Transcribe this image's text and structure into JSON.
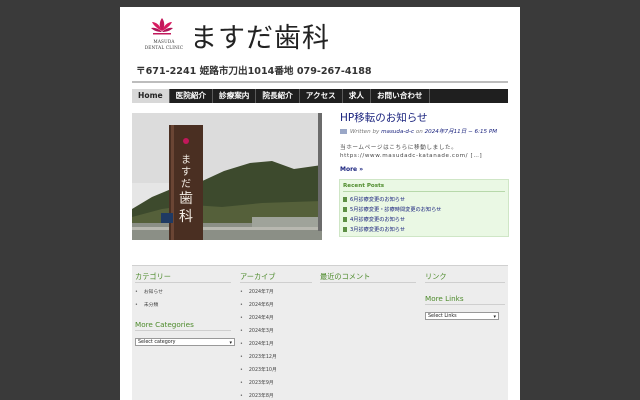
{
  "header": {
    "logo_en_line1": "MASUDA",
    "logo_en_line2": "DENTAL CLINIC",
    "site_name": "ますだ歯科",
    "address": "〒671-2241  姫路市刀出1014番地  079-267-4188"
  },
  "nav": {
    "items": [
      "Home",
      "医院紹介",
      "診療案内",
      "院長紹介",
      "アクセス",
      "求人",
      "お問い合わせ"
    ],
    "active_index": 0
  },
  "hero": {
    "sign_text": "ますだ歯科"
  },
  "post": {
    "title": "HP移転のお知らせ",
    "meta_prefix": "Written by",
    "author": "masuda-d-c",
    "meta_on": "on",
    "date": "2024年7月11日 − 6:15 PM",
    "excerpt": "当ホームページはこちらに移動しました。https://www.masudadc-katanade.com/ […]",
    "more": "More »"
  },
  "recent_posts": {
    "title": "Recent Posts",
    "items": [
      "6月診療変更のお知らせ",
      "5月診療変更・診療時間変更のお知らせ",
      "4月診療変更のお知らせ",
      "3月診療変更のお知らせ"
    ]
  },
  "footer": {
    "categories": {
      "title": "カテゴリー",
      "items": [
        "お知らせ",
        "未分類"
      ]
    },
    "more_categories": {
      "title": "More Categories",
      "select": "Select category"
    },
    "archive": {
      "title": "アーカイブ",
      "items": [
        "2024年7月",
        "2024年6月",
        "2024年4月",
        "2024年3月",
        "2024年1月",
        "2023年12月",
        "2023年10月",
        "2023年9月",
        "2023年8月"
      ]
    },
    "recent_comments": {
      "title": "最近のコメント"
    },
    "links": {
      "title": "リンク"
    },
    "more_links": {
      "title": "More Links",
      "select": "Select Links"
    }
  },
  "colors": {
    "nav_bg": "#1f1f1f",
    "link": "#1a237e",
    "accent_green": "#4c8a2a",
    "logo_pink": "#c2185b"
  }
}
